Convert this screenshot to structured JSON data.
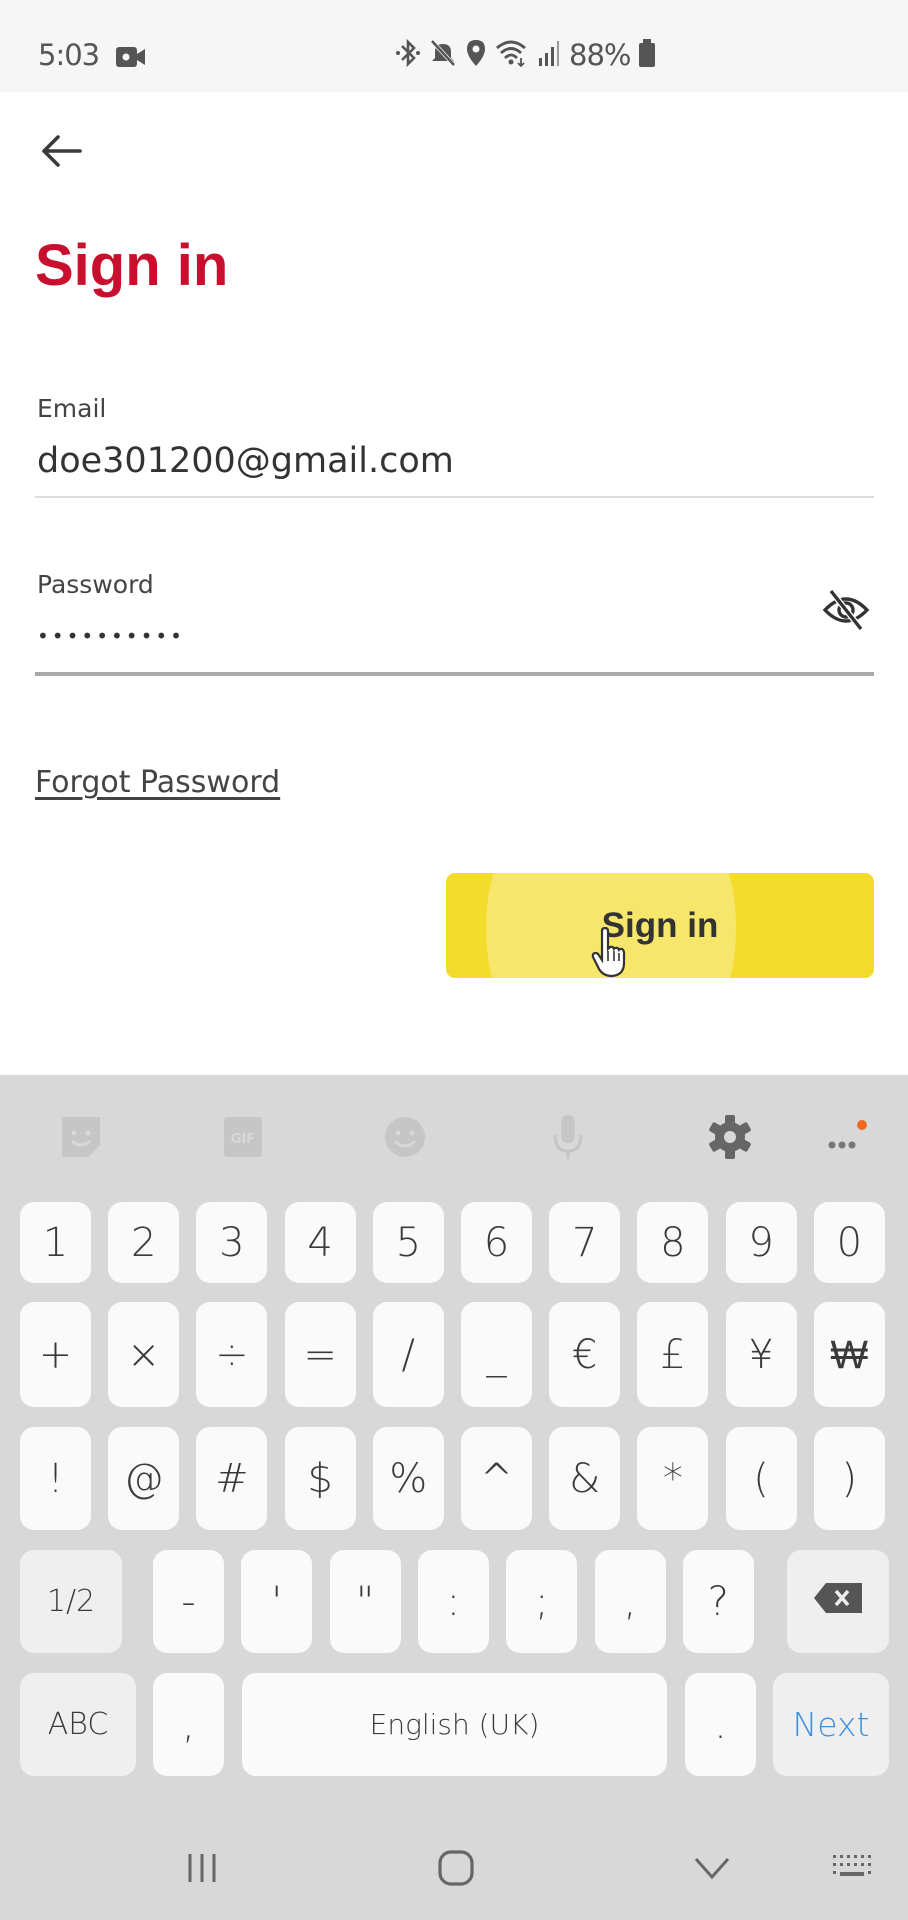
{
  "status_bar": {
    "time": "5:03",
    "battery": "88%",
    "icons": [
      "video-recording-icon",
      "bluetooth-icon",
      "mute-icon",
      "location-icon",
      "wifi-icon",
      "signal-icon",
      "battery-icon"
    ]
  },
  "header": {
    "back_icon": "arrow-left-icon",
    "title": "Sign in"
  },
  "form": {
    "email_label": "Email",
    "email_value": "doe301200@gmail.com",
    "password_label": "Password",
    "password_value": "••••••••••",
    "password_toggle_icon": "eye-off-icon",
    "forgot_password": "Forgot Password",
    "submit_label": "Sign in"
  },
  "colors": {
    "title_red": "#c8102e",
    "button_yellow": "#f3dc2b",
    "keyboard_bg": "#d8d8d8",
    "next_blue": "#3d8fe0",
    "notification_dot": "#f26a21"
  },
  "keyboard": {
    "toolbar": [
      "sticker-icon",
      "gif-icon",
      "emoji-icon",
      "microphone-icon",
      "settings-icon",
      "more-icon"
    ],
    "row1": [
      "1",
      "2",
      "3",
      "4",
      "5",
      "6",
      "7",
      "8",
      "9",
      "0"
    ],
    "row2": [
      "+",
      "×",
      "÷",
      "=",
      "/",
      "_",
      "€",
      "£",
      "¥",
      "₩"
    ],
    "row3": [
      "!",
      "@",
      "#",
      "$",
      "%",
      "^",
      "&",
      "*",
      "(",
      ")"
    ],
    "row4": {
      "page_toggle": "1/2",
      "keys": [
        "-",
        "'",
        "\"",
        ":",
        ";",
        ",",
        "?"
      ],
      "backspace_icon": "backspace-icon"
    },
    "row5": {
      "abc": "ABC",
      "comma": ",",
      "space": "English (UK)",
      "period": ".",
      "action": "Next"
    }
  },
  "nav_bar": {
    "buttons": [
      "recent-apps-icon",
      "home-icon",
      "hide-keyboard-icon",
      "keyboard-switch-icon"
    ]
  }
}
